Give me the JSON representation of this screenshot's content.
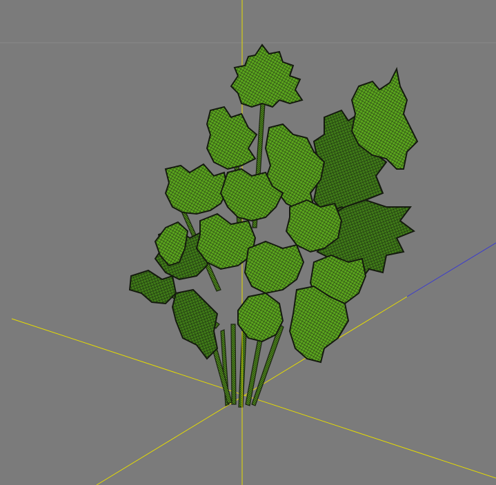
{
  "viewport": {
    "background": "#7b7b7b",
    "grid_color": "#8c8c8c",
    "axis_color_primary": "#e6dc00",
    "axis_color_secondary": "#3a3ad0",
    "object": {
      "name": "parsley-plant",
      "display": "wireframe-on-shaded",
      "leaf_color": "#5aa51e",
      "leaf_dark": "#2d5a0e",
      "wire_color": "#1a1f14"
    }
  }
}
